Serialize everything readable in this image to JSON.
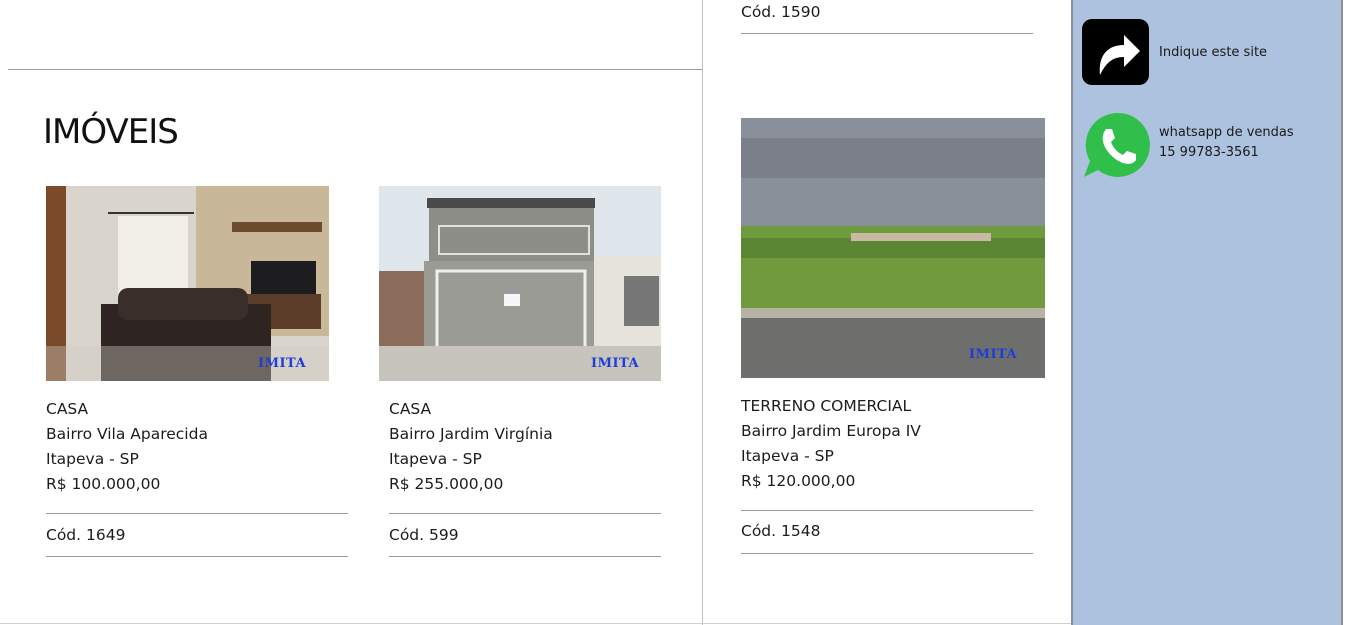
{
  "page": {
    "section_title": "IMÓVEIS"
  },
  "top_card": {
    "code": "Cód. 1590"
  },
  "listings": [
    {
      "type": "CASA",
      "neighborhood": "Bairro Vila Aparecida",
      "city": "Itapeva - SP",
      "price": "R$ 100.000,00",
      "code": "Cód. 1649",
      "watermark": "IMITA"
    },
    {
      "type": "CASA",
      "neighborhood": "Bairro Jardim Virgínia",
      "city": "Itapeva - SP",
      "price": "R$ 255.000,00",
      "code": "Cód. 599",
      "watermark": "IMITA"
    },
    {
      "type": "TERRENO COMERCIAL",
      "neighborhood": "Bairro Jardim Europa IV",
      "city": "Itapeva - SP",
      "price": "R$ 120.000,00",
      "code": "Cód. 1548",
      "watermark": "IMITA"
    }
  ],
  "sidebar": {
    "share": {
      "icon": "share-arrow-icon",
      "label": "Indique este site"
    },
    "whatsapp": {
      "icon": "whatsapp-icon",
      "label": "whatsapp de vendas",
      "phone": "15 99783-3561"
    }
  },
  "colors": {
    "sidebar_bg": "#adc2de",
    "watermark": "#1e3cd8",
    "whatsapp_green": "#2fbf4a"
  }
}
